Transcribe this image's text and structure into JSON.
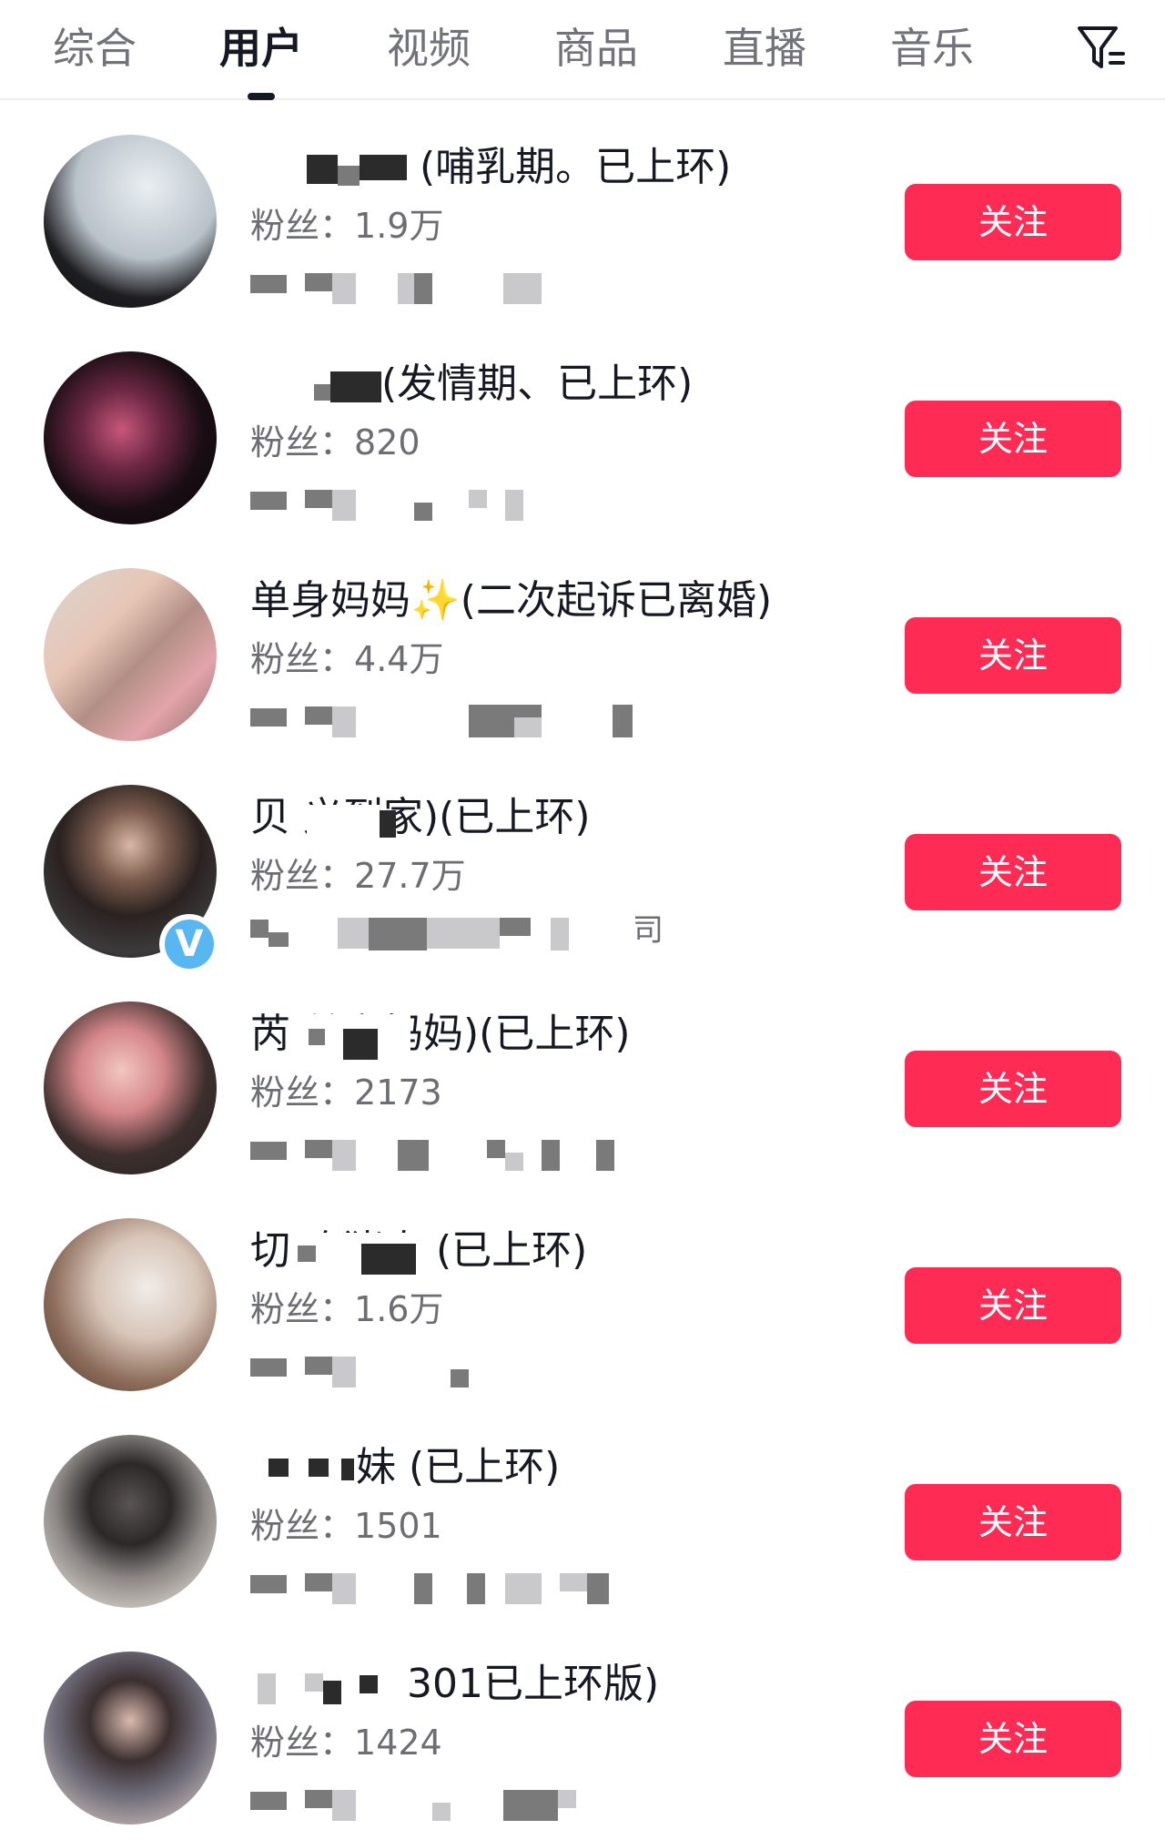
{
  "tabs": [
    {
      "label": "综合",
      "active": false
    },
    {
      "label": "用户",
      "active": true
    },
    {
      "label": "视频",
      "active": false
    },
    {
      "label": "商品",
      "active": false
    },
    {
      "label": "直播",
      "active": false
    },
    {
      "label": "音乐",
      "active": false
    }
  ],
  "filter_icon": "filter-funnel-icon",
  "colors": {
    "follow_button": "#fe2c55",
    "active_tab": "#161823",
    "inactive_tab": "#72737a",
    "fans_text": "#6d6e74",
    "verified_badge": "#58b6f0"
  },
  "users": [
    {
      "name": "(哺乳期。已上环)",
      "fans_label": "粉丝：",
      "fans_count": "1.9万",
      "follow_label": "关注",
      "verified": false
    },
    {
      "name": "(发情期、已上环)",
      "fans_label": "粉丝：",
      "fans_count": "820",
      "follow_label": "关注",
      "verified": false
    },
    {
      "name": "单身妈妈✨(二次起诉已离婚)",
      "fans_label": "粉丝：",
      "fans_count": "4.4万",
      "follow_label": "关注",
      "verified": false
    },
    {
      "name": "贝 义到家)(已上环)",
      "fans_label": "粉丝：",
      "fans_count": "27.7万",
      "follow_label": "关注",
      "verified": true,
      "bio_suffix": "司"
    },
    {
      "name": "芮 单亲妈妈)(已上环)",
      "fans_label": "粉丝：",
      "fans_count": "2173",
      "follow_label": "关注",
      "verified": false
    },
    {
      "name": "切 吃猪肉 (已上环)",
      "fans_label": "粉丝：",
      "fans_count": "1.6万",
      "follow_label": "关注",
      "verified": false
    },
    {
      "name": "妹 (已上环)",
      "fans_label": "粉丝：",
      "fans_count": "1501",
      "follow_label": "关注",
      "verified": false
    },
    {
      "name": "301已上环版)",
      "fans_label": "粉丝：",
      "fans_count": "1424",
      "follow_label": "关注",
      "verified": false
    }
  ]
}
